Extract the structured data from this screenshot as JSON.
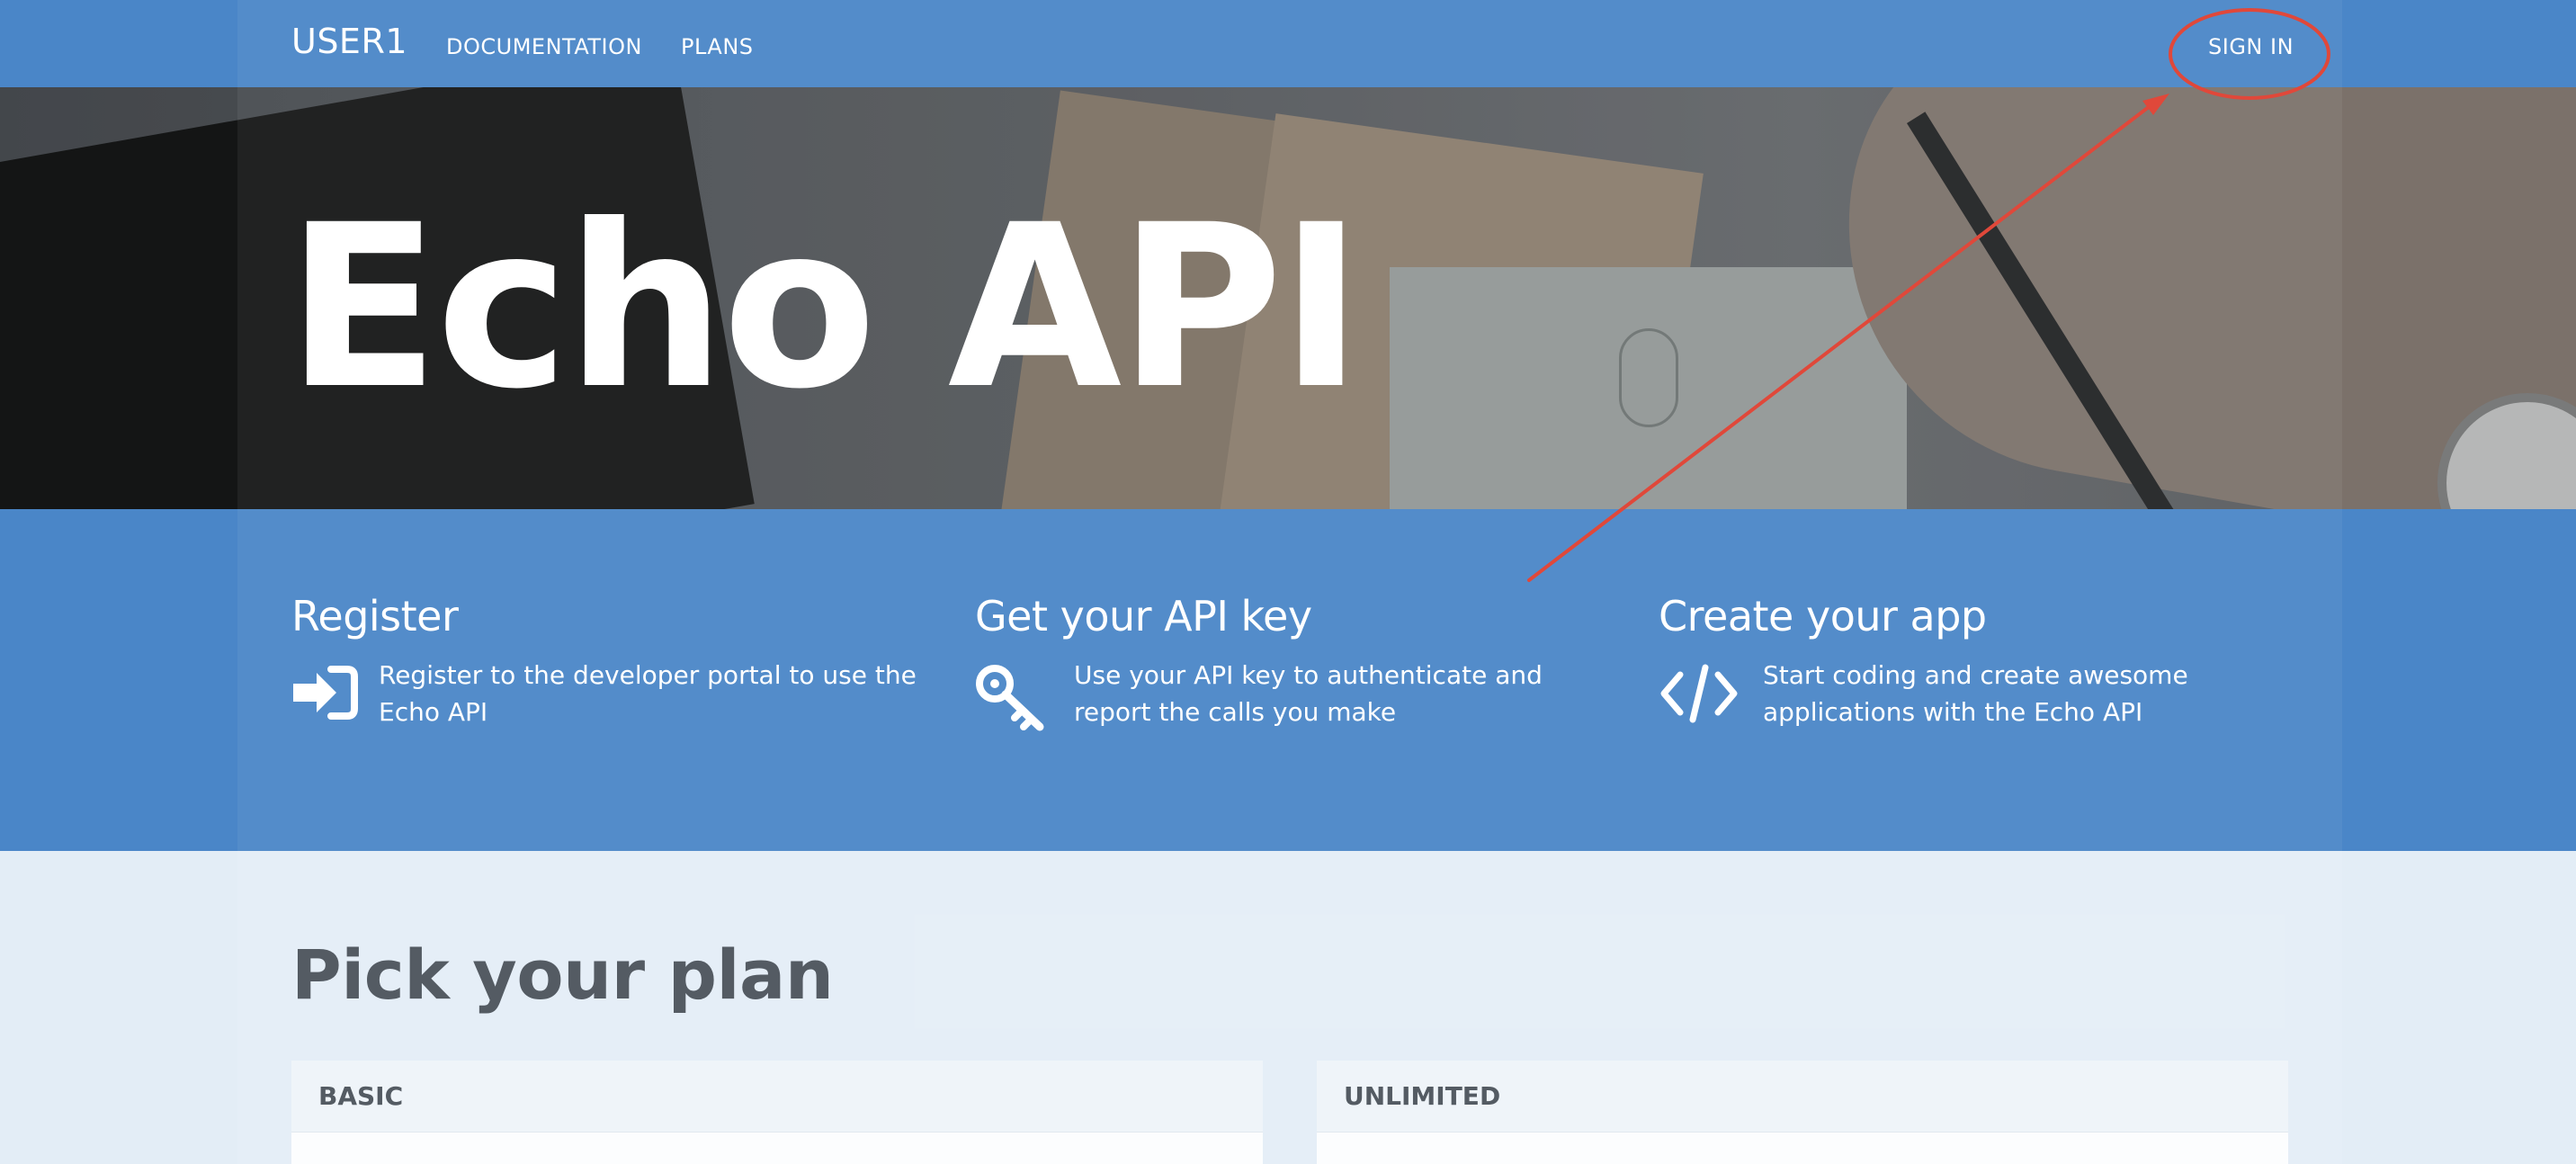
{
  "navbar": {
    "brand": "USER1",
    "links": [
      "DOCUMENTATION",
      "PLANS"
    ],
    "sign_in": "SIGN IN"
  },
  "hero": {
    "title": "Echo API"
  },
  "features": [
    {
      "title": "Register",
      "text": "Register to the developer portal to use the Echo API",
      "icon": "sign-in-arrow-icon"
    },
    {
      "title": "Get your API key",
      "text": "Use your API key to authenticate and report the calls you make",
      "icon": "key-icon"
    },
    {
      "title": "Create your app",
      "text": "Start coding and create awesome applications with the Echo API",
      "icon": "code-icon"
    }
  ],
  "plans": {
    "title": "Pick your plan",
    "cards": [
      "BASIC",
      "UNLIMITED"
    ]
  },
  "colors": {
    "primary": "#4a86c8",
    "background": "#e3edf6",
    "annotation": "#e0483a"
  }
}
